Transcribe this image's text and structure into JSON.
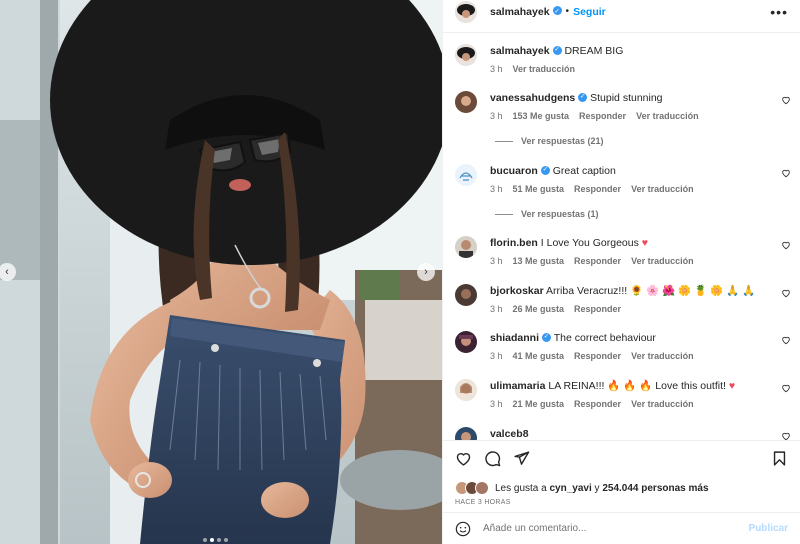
{
  "post": {
    "author": "salmahayek",
    "follow_label": "Seguir",
    "separator": "•",
    "more_label": "•••",
    "caption": {
      "username": "salmahayek",
      "text": "DREAM BIG",
      "time": "3 h",
      "translate": "Ver traducción"
    }
  },
  "comments": [
    {
      "username": "vanessahudgens",
      "verified": true,
      "text": "Stupid stunning",
      "time": "3 h",
      "likes": "153 Me gusta",
      "reply": "Responder",
      "translate": "Ver traducción",
      "replies": "Ver respuestas (21)"
    },
    {
      "username": "bucuaron",
      "verified": true,
      "text": "Great caption",
      "time": "3 h",
      "likes": "51 Me gusta",
      "reply": "Responder",
      "translate": "Ver traducción",
      "replies": "Ver respuestas (1)"
    },
    {
      "username": "florin.ben",
      "verified": false,
      "text": "I Love You Gorgeous",
      "emoji": "♥",
      "time": "3 h",
      "likes": "13 Me gusta",
      "reply": "Responder",
      "translate": "Ver traducción"
    },
    {
      "username": "bjorkoskar",
      "verified": false,
      "text": "Arriba Veracruz!!! 🌻 🌸 🌺 🌼 🍍 🌼 🙏 🙏",
      "time": "3 h",
      "likes": "26 Me gusta",
      "reply": "Responder"
    },
    {
      "username": "shiadanni",
      "verified": true,
      "text": "The correct behaviour",
      "time": "3 h",
      "likes": "41 Me gusta",
      "reply": "Responder",
      "translate": "Ver traducción"
    },
    {
      "username": "ulimamaria",
      "verified": false,
      "text": "LA REINA!!! 🔥 🔥 🔥 Love this outfit!",
      "emoji": "♥",
      "time": "3 h",
      "likes": "21 Me gusta",
      "reply": "Responder",
      "translate": "Ver traducción"
    },
    {
      "username": "valceb8",
      "verified": false,
      "text": ""
    }
  ],
  "footer": {
    "likes_prefix": "Les gusta a",
    "likes_user": "cyn_yavi",
    "likes_mid": "y",
    "likes_count": "254.044 personas más",
    "ago": "HACE 3 HORAS",
    "comment_placeholder": "Añade un comentario...",
    "publish": "Publicar"
  },
  "carousel": {
    "slides": 4,
    "active": 2
  },
  "colors": {
    "accent": "#0095f6",
    "verified": "#3897f0",
    "heart": "#ed4956",
    "muted": "#737373"
  }
}
